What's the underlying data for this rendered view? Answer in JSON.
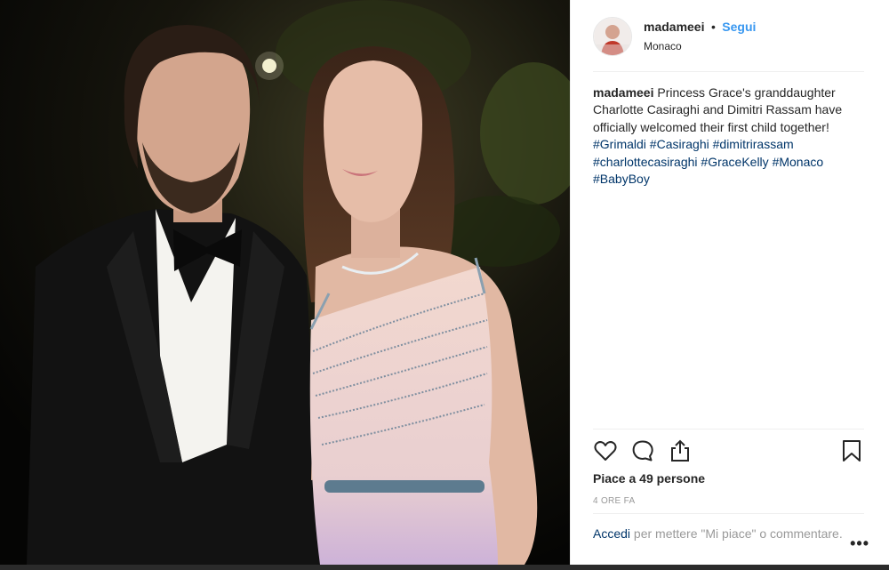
{
  "header": {
    "username": "madameei",
    "separator": "•",
    "follow_label": "Segui",
    "location": "Monaco"
  },
  "caption": {
    "username": "madameei",
    "text": "Princess Grace's granddaughter Charlotte Casiraghi and Dimitri Rassam have officially welcomed their first child together!",
    "hashtags": [
      "#Grimaldi",
      "#Casiraghi",
      "#dimitrirassam",
      "#charlottecasiraghi",
      "#GraceKelly",
      "#Monaco",
      "#BabyBoy"
    ]
  },
  "stats": {
    "likes": "Piace a 49 persone",
    "time": "4 ORE FA"
  },
  "login_prompt": {
    "link": "Accedi",
    "text": "per mettere \"Mi piace\" o commentare."
  },
  "more_label": "•••",
  "colors": {
    "follow": "#3897f0",
    "hashtag": "#003569",
    "muted": "#999999",
    "text": "#262626"
  }
}
